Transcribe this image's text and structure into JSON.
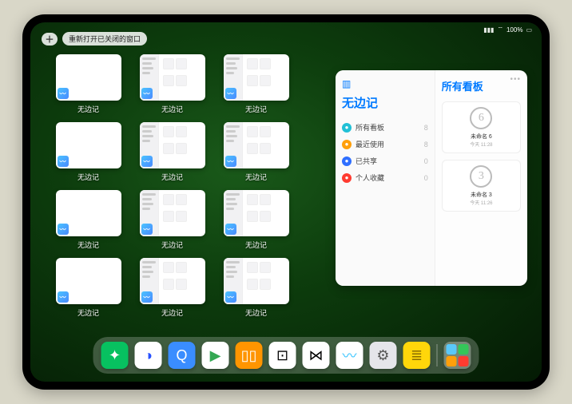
{
  "status": {
    "time_or_pct": "100%"
  },
  "top_controls": {
    "plus": "＋",
    "reopen_label": "重新打开已关闭的窗口"
  },
  "app_windows": [
    {
      "label": "无边记",
      "variant": "blank"
    },
    {
      "label": "无边记",
      "variant": "content"
    },
    {
      "label": "无边记",
      "variant": "content"
    },
    {
      "label": "无边记",
      "variant": "blank"
    },
    {
      "label": "无边记",
      "variant": "content"
    },
    {
      "label": "无边记",
      "variant": "content"
    },
    {
      "label": "无边记",
      "variant": "blank"
    },
    {
      "label": "无边记",
      "variant": "content"
    },
    {
      "label": "无边记",
      "variant": "content"
    },
    {
      "label": "无边记",
      "variant": "blank"
    },
    {
      "label": "无边记",
      "variant": "content"
    },
    {
      "label": "无边记",
      "variant": "content"
    }
  ],
  "panel": {
    "sidebar_title": "无边记",
    "items": [
      {
        "label": "所有看板",
        "color": "#21c0d6",
        "count": 8
      },
      {
        "label": "最近使用",
        "color": "#ff9f0a",
        "count": 8
      },
      {
        "label": "已共享",
        "color": "#2f6fff",
        "count": 0
      },
      {
        "label": "个人收藏",
        "color": "#ff3b30",
        "count": 0
      }
    ],
    "right_title": "所有看板",
    "boards": [
      {
        "sketch": "6",
        "name": "未命名 6",
        "time": "今天 11:28"
      },
      {
        "sketch": "3",
        "name": "未命名 3",
        "time": "今天 11:26"
      }
    ]
  },
  "dock": [
    {
      "name": "wechat",
      "bg": "#07c160",
      "glyph": "✦",
      "glyphColor": "#fff"
    },
    {
      "name": "quark",
      "bg": "#ffffff",
      "glyph": "◑",
      "glyphColor": "#2852ff"
    },
    {
      "name": "browser-q",
      "bg": "#3a8dff",
      "glyph": "Q",
      "glyphColor": "#fff"
    },
    {
      "name": "play",
      "bg": "#ffffff",
      "glyph": "▶",
      "glyphColor": "#34a853"
    },
    {
      "name": "books",
      "bg": "#ff9500",
      "glyph": "▯▯",
      "glyphColor": "#fff"
    },
    {
      "name": "dice",
      "bg": "#ffffff",
      "glyph": "⊡",
      "glyphColor": "#000"
    },
    {
      "name": "connect",
      "bg": "#ffffff",
      "glyph": "⋈",
      "glyphColor": "#000"
    },
    {
      "name": "freeform",
      "bg": "#ffffff",
      "glyph": "〰",
      "glyphColor": "#34c3ff"
    },
    {
      "name": "settings",
      "bg": "#e5e5ea",
      "glyph": "⚙",
      "glyphColor": "#555"
    },
    {
      "name": "notes",
      "bg": "#ffd60a",
      "glyph": "≣",
      "glyphColor": "#8a6d00"
    }
  ],
  "dock_folder_colors": [
    "#5ac8fa",
    "#34c759",
    "#ff9f0a",
    "#ff3b30"
  ]
}
